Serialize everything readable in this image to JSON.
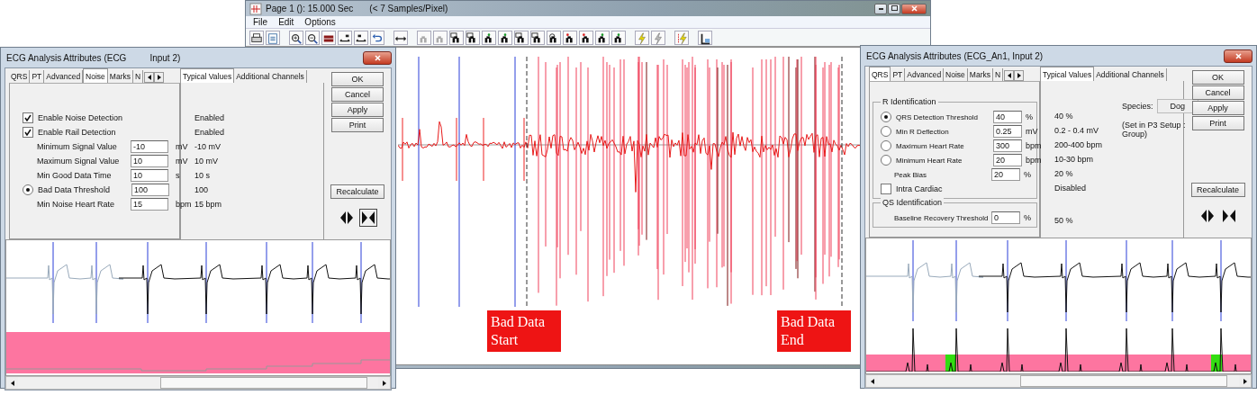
{
  "main_window": {
    "title": "Page 1 (): 15.000 Sec",
    "title_note": "(< 7 Samples/Pixel)",
    "menu": [
      "File",
      "Edit",
      "Options"
    ],
    "annotations": [
      {
        "text": "Bad Data Start"
      },
      {
        "text": "Bad Data End"
      }
    ]
  },
  "dialogs": [
    {
      "title": "ECG Analysis Attributes  (ECG",
      "title_suffix": "Input 2)",
      "tabs": [
        {
          "label": "QRS",
          "selected": false
        },
        {
          "label": "PT",
          "selected": false
        },
        {
          "label": "Advanced",
          "selected": false
        },
        {
          "label": "Noise",
          "selected": true
        },
        {
          "label": "Marks",
          "selected": false
        },
        {
          "label": "N",
          "selected": false
        }
      ],
      "value_tabs": [
        {
          "label": "Typical Values",
          "selected": true
        },
        {
          "label": "Additional Channels",
          "selected": false
        }
      ],
      "groups": [
        {
          "rows": [
            {
              "kind": "checkbox",
              "label": "Enable Noise Detection",
              "checked": true,
              "typical": "Enabled"
            },
            {
              "kind": "checkbox",
              "label": "Enable Rail Detection",
              "checked": true,
              "typical": "Enabled"
            },
            {
              "kind": "field",
              "label": "Minimum Signal Value",
              "value": "-10",
              "unit": "mV",
              "typical": "-10 mV"
            },
            {
              "kind": "field",
              "label": "Maximum Signal Value",
              "value": "10",
              "unit": "mV",
              "typical": "10 mV"
            },
            {
              "kind": "field",
              "label": "Min Good Data Time",
              "value": "10",
              "unit": "s",
              "typical": "10 s"
            },
            {
              "kind": "radio",
              "label": "Bad Data Threshold",
              "value": "100",
              "selected": true,
              "typical": "100"
            },
            {
              "kind": "field",
              "label": "Min Noise Heart Rate",
              "value": "15",
              "unit": "bpm",
              "typical": "15 bpm"
            }
          ]
        }
      ],
      "buttons": [
        "OK",
        "Cancel",
        "Apply",
        "Print"
      ],
      "recalculate": "Recalculate",
      "view_buttons": [
        {
          "selected": false
        },
        {
          "selected": true
        }
      ],
      "preview": {
        "kind": "noise"
      }
    },
    {
      "title": "ECG Analysis Attributes  (ECG_An1, Input 2)",
      "tabs": [
        {
          "label": "QRS",
          "selected": true
        },
        {
          "label": "PT",
          "selected": false
        },
        {
          "label": "Advanced",
          "selected": false
        },
        {
          "label": "Noise",
          "selected": false
        },
        {
          "label": "Marks",
          "selected": false
        },
        {
          "label": "N",
          "selected": false
        }
      ],
      "value_tabs": [
        {
          "label": "Typical Values",
          "selected": true
        },
        {
          "label": "Additional Channels",
          "selected": false
        }
      ],
      "species": {
        "label": "Species:",
        "value": "Dog",
        "note": "(Set in P3 Setup : Group)"
      },
      "groups": [
        {
          "title": "R Identification",
          "rows": [
            {
              "kind": "radio",
              "label": "QRS Detection Threshold",
              "value": "40",
              "unit": "%",
              "selected": true,
              "typical": "40 %"
            },
            {
              "kind": "radio",
              "label": "Min R Deflection",
              "value": "0.25",
              "unit": "mV",
              "selected": false,
              "typical": "0.2 - 0.4 mV"
            },
            {
              "kind": "radio",
              "label": "Maximum Heart Rate",
              "value": "300",
              "unit": "bpm",
              "selected": false,
              "typical": "200-400 bpm"
            },
            {
              "kind": "radio",
              "label": "Minimum Heart Rate",
              "value": "20",
              "unit": "bpm",
              "selected": false,
              "typical": "10-30 bpm"
            },
            {
              "kind": "field",
              "label": "Peak Bias",
              "value": "20",
              "unit": "%",
              "typical": "20 %"
            },
            {
              "kind": "checkbox",
              "label": "Intra Cardiac",
              "checked": false,
              "typical": "Disabled"
            }
          ]
        },
        {
          "title": "QS Identification",
          "rows": [
            {
              "kind": "field",
              "label": "Baseline Recovery Threshold",
              "value": "0",
              "unit": "%",
              "typical": "50 %"
            }
          ]
        }
      ],
      "buttons": [
        "OK",
        "Cancel",
        "Apply",
        "Print"
      ],
      "recalculate": "Recalculate",
      "view_buttons": [
        {
          "selected": false
        },
        {
          "selected": false
        }
      ],
      "preview": {
        "kind": "qrs"
      }
    }
  ]
}
